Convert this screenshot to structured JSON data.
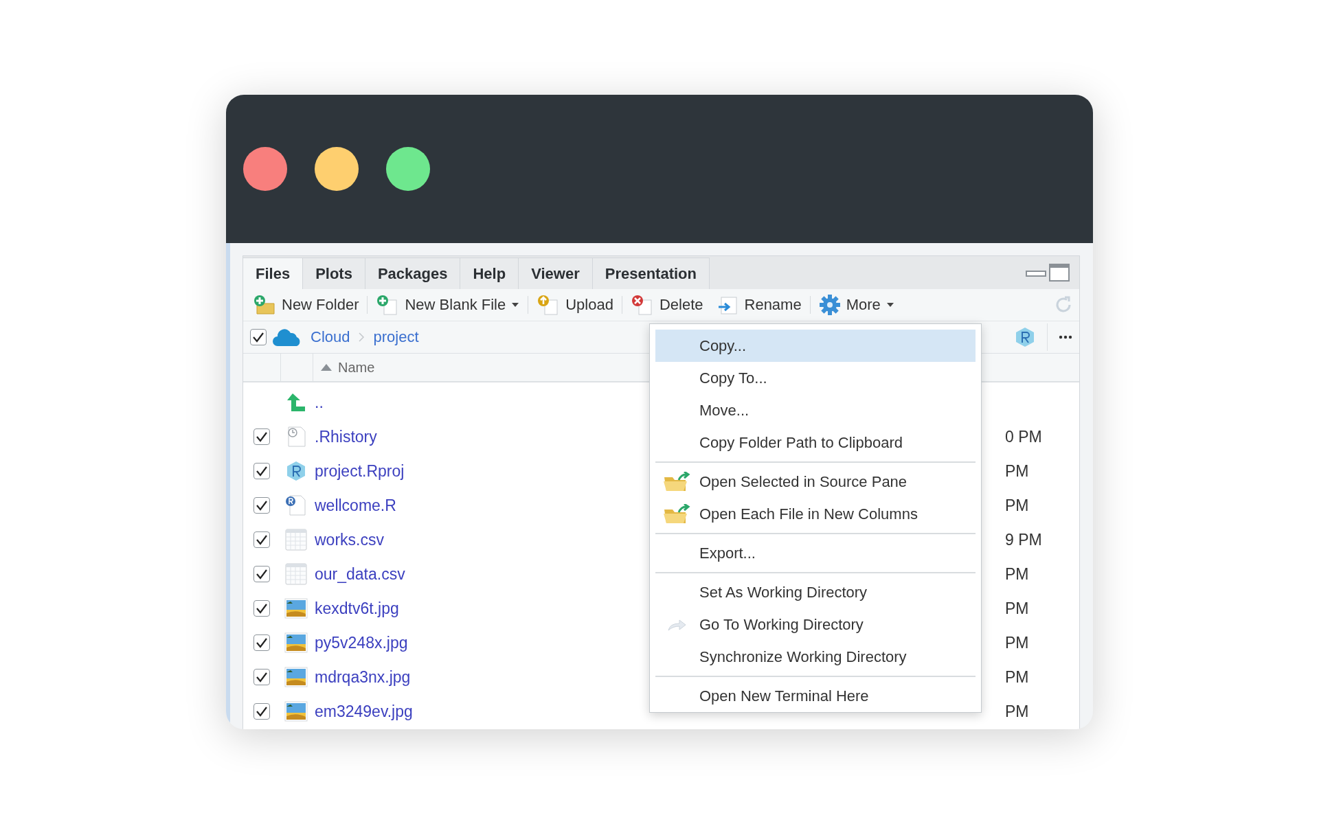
{
  "tabs": [
    {
      "label": "Files",
      "selected": true
    },
    {
      "label": "Plots",
      "selected": false
    },
    {
      "label": "Packages",
      "selected": false
    },
    {
      "label": "Help",
      "selected": false
    },
    {
      "label": "Viewer",
      "selected": false
    },
    {
      "label": "Presentation",
      "selected": false
    }
  ],
  "toolbar": [
    {
      "label": "New Folder",
      "kind": "new-folder",
      "dropdown": false
    },
    {
      "label": "New Blank File",
      "kind": "new-file",
      "dropdown": true
    },
    {
      "label": "Upload",
      "kind": "upload",
      "dropdown": false
    },
    {
      "label": "Delete",
      "kind": "delete",
      "dropdown": false
    },
    {
      "label": "Rename",
      "kind": "rename",
      "dropdown": false
    },
    {
      "label": "More",
      "kind": "more",
      "dropdown": true
    }
  ],
  "breadcrumb": {
    "checked": true,
    "path": [
      "Cloud",
      "project"
    ]
  },
  "table": {
    "columns": [
      "Name"
    ],
    "rows": [
      {
        "kind": "parent",
        "name": ".."
      },
      {
        "kind": "history",
        "name": ".Rhistory",
        "checked": true,
        "modified": "0 PM"
      },
      {
        "kind": "rproj",
        "name": "project.Rproj",
        "checked": true,
        "modified": "PM"
      },
      {
        "kind": "rscript",
        "name": "wellcome.R",
        "checked": true,
        "modified": "PM"
      },
      {
        "kind": "csv",
        "name": "works.csv",
        "checked": true,
        "modified": "9 PM"
      },
      {
        "kind": "csv",
        "name": "our_data.csv",
        "checked": true,
        "modified": "PM"
      },
      {
        "kind": "image",
        "name": "kexdtv6t.jpg",
        "checked": true,
        "modified": "PM"
      },
      {
        "kind": "image",
        "name": "py5v248x.jpg",
        "checked": true,
        "modified": "PM"
      },
      {
        "kind": "image",
        "name": "mdrqa3nx.jpg",
        "checked": true,
        "modified": "PM"
      },
      {
        "kind": "image",
        "name": "em3249ev.jpg",
        "checked": true,
        "modified": "PM"
      }
    ]
  },
  "context_menu": [
    {
      "kind": "item",
      "label": "Copy...",
      "selected": true
    },
    {
      "kind": "item",
      "label": "Copy To...",
      "selected": false
    },
    {
      "kind": "item",
      "label": "Move...",
      "selected": false
    },
    {
      "kind": "item",
      "label": "Copy Folder Path to Clipboard",
      "selected": false
    },
    {
      "kind": "separator"
    },
    {
      "kind": "open",
      "label": "Open Selected in Source Pane",
      "selected": false
    },
    {
      "kind": "open",
      "label": "Open Each File in New Columns",
      "selected": false
    },
    {
      "kind": "separator"
    },
    {
      "kind": "item",
      "label": "Export...",
      "selected": false
    },
    {
      "kind": "separator"
    },
    {
      "kind": "item",
      "label": "Set As Working Directory",
      "selected": false
    },
    {
      "kind": "goto",
      "label": "Go To Working Directory",
      "selected": false
    },
    {
      "kind": "item",
      "label": "Synchronize Working Directory",
      "selected": false
    },
    {
      "kind": "separator"
    },
    {
      "kind": "item",
      "label": "Open New Terminal Here",
      "selected": false
    }
  ]
}
